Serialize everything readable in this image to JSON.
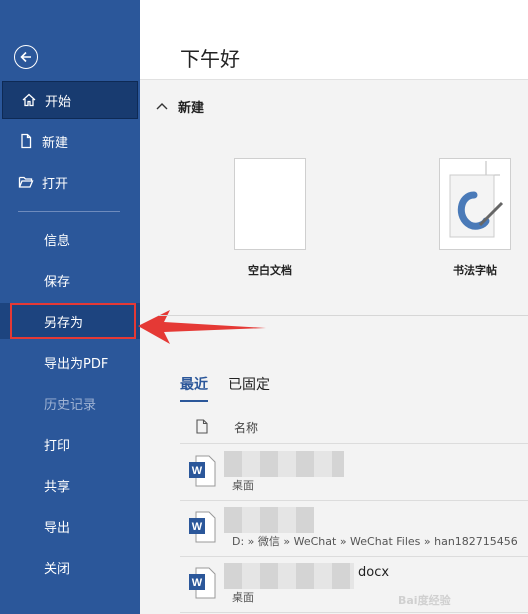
{
  "sidebar": {
    "items": [
      {
        "label": "开始",
        "icon": "home-icon"
      },
      {
        "label": "新建",
        "icon": "new-doc-icon"
      },
      {
        "label": "打开",
        "icon": "folder-open-icon"
      }
    ],
    "sub_items": [
      {
        "label": "信息"
      },
      {
        "label": "保存"
      },
      {
        "label": "另存为"
      },
      {
        "label": "导出为PDF"
      },
      {
        "label": "历史记录"
      },
      {
        "label": "打印"
      },
      {
        "label": "共享"
      },
      {
        "label": "导出"
      },
      {
        "label": "关闭"
      }
    ],
    "accent": "#2b579a",
    "highlight_color": "#e53935"
  },
  "header": {
    "greeting": "下午好"
  },
  "new_section": {
    "title": "新建",
    "templates": [
      {
        "label": "空白文档"
      },
      {
        "label": "书法字帖"
      }
    ]
  },
  "recent": {
    "tabs": [
      {
        "label": "最近"
      },
      {
        "label": "已固定"
      }
    ],
    "column_name": "名称",
    "files": [
      {
        "name": "",
        "location": "桌面"
      },
      {
        "name": "",
        "location": "D: » 微信 » WeChat » WeChat Files » han182715456"
      },
      {
        "name": "docx",
        "location": "桌面"
      }
    ]
  },
  "watermark": "Bai度经验"
}
